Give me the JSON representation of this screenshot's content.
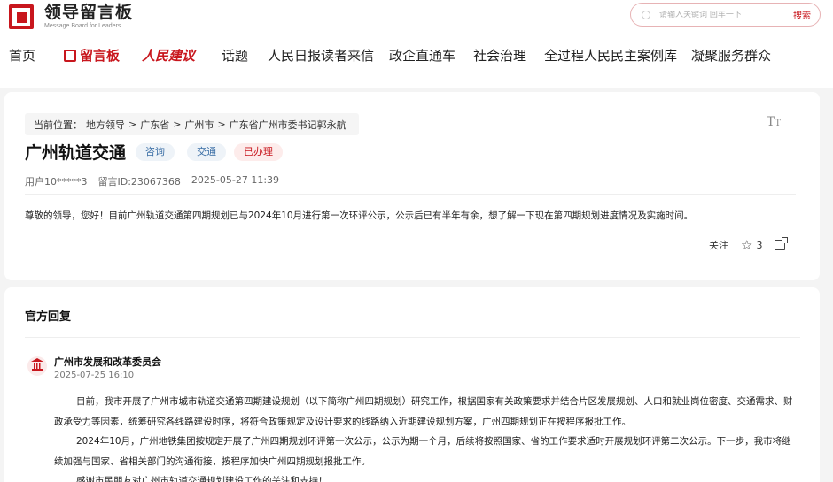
{
  "header": {
    "logo_title": "领导留言板",
    "logo_subtitle": "Message Board for Leaders",
    "search_placeholder": "请输入关键词 回车一下",
    "search_button": "搜索"
  },
  "nav": {
    "items": [
      "首页",
      "留言板",
      "人民建议",
      "话题",
      "人民日报读者来信",
      "政企直通车",
      "社会治理",
      "全过程人民民主案例库",
      "凝聚服务群众"
    ]
  },
  "breadcrumb": {
    "prefix": "当前位置：",
    "items": [
      "地方领导",
      "广东省",
      "广州市",
      "广东省广州市委书记郭永航"
    ],
    "separator": ">"
  },
  "message": {
    "title": "广州轨道交通",
    "tags": [
      "咨询",
      "交通",
      "已办理"
    ],
    "user": "用户10*****3",
    "id": "留言ID:23067368",
    "time": "2025-05-27 11:39",
    "body": "尊敬的领导，您好！目前广州轨道交通第四期规划已与2024年10月进行第一次环评公示，公示后已有半年有余，想了解一下现在第四期规划进度情况及实施时间。",
    "follow_label": "关注",
    "star_count": "3"
  },
  "reply": {
    "heading": "官方回复",
    "org": "广州市发展和改革委员会",
    "date": "2025-07-25 16:10",
    "paragraphs": [
      "目前，我市开展了广州市城市轨道交通第四期建设规划（以下简称广州四期规划）研究工作，根据国家有关政策要求并结合片区发展规划、人口和就业岗位密度、交通需求、财政承受力等因素，统筹研究各线路建设时序，将符合政策规定及设计要求的线路纳入近期建设规划方案，广州四期规划正在按程序报批工作。",
      "2024年10月，广州地铁集团按规定开展了广州四期规划环评第一次公示，公示为期一个月，后续将按照国家、省的工作要求适时开展规划环评第二次公示。下一步，我市将继续加强与国家、省相关部门的沟通衔接，按程序加快广州四期规划报批工作。",
      "感谢市民朋友对广州市轨道交通规划建设工作的关注和支持！"
    ]
  },
  "colors": {
    "brand_red": "#c8161d",
    "tag_blue": "#3a6ea5",
    "background": "#f4f4f4"
  }
}
